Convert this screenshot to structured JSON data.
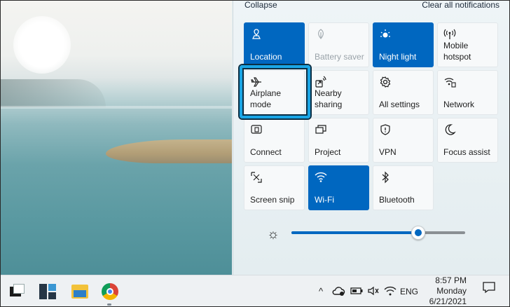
{
  "panel": {
    "collapse_label": "Collapse",
    "clear_label": "Clear all notifications"
  },
  "tiles": [
    {
      "label": "Location",
      "icon": "location-icon",
      "state": "on"
    },
    {
      "label": "Battery saver",
      "icon": "battery-saver-icon",
      "state": "disabled"
    },
    {
      "label": "Night light",
      "icon": "night-light-icon",
      "state": "on"
    },
    {
      "label": "Mobile\nhotspot",
      "icon": "mobile-hotspot-icon",
      "state": "off"
    },
    {
      "label": "Airplane\nmode",
      "icon": "airplane-icon",
      "state": "off"
    },
    {
      "label": "Nearby\nsharing",
      "icon": "nearby-sharing-icon",
      "state": "off"
    },
    {
      "label": "All settings",
      "icon": "gear-icon",
      "state": "off"
    },
    {
      "label": "Network",
      "icon": "network-icon",
      "state": "off"
    },
    {
      "label": "Connect",
      "icon": "connect-icon",
      "state": "off"
    },
    {
      "label": "Project",
      "icon": "project-icon",
      "state": "off"
    },
    {
      "label": "VPN",
      "icon": "vpn-shield-icon",
      "state": "off"
    },
    {
      "label": "Focus assist",
      "icon": "moon-icon",
      "state": "off"
    },
    {
      "label": "Screen snip",
      "icon": "scissors-icon",
      "state": "off"
    },
    {
      "label": "Wi-Fi",
      "icon": "wifi-icon",
      "state": "on"
    },
    {
      "label": "Bluetooth",
      "icon": "bluetooth-icon",
      "state": "off"
    }
  ],
  "brightness": {
    "icon": "brightness-icon",
    "level_percent": 73
  },
  "taskbar": {
    "apps": [
      "start-button",
      "widgets",
      "file-explorer",
      "chrome"
    ],
    "tray": {
      "chevron": "^",
      "lang": "ENG",
      "time": "8:57 PM",
      "day": "Monday",
      "date": "6/21/2021"
    }
  },
  "colors": {
    "accent": "#0067c0",
    "highlight_border": "#1aa6e6"
  }
}
